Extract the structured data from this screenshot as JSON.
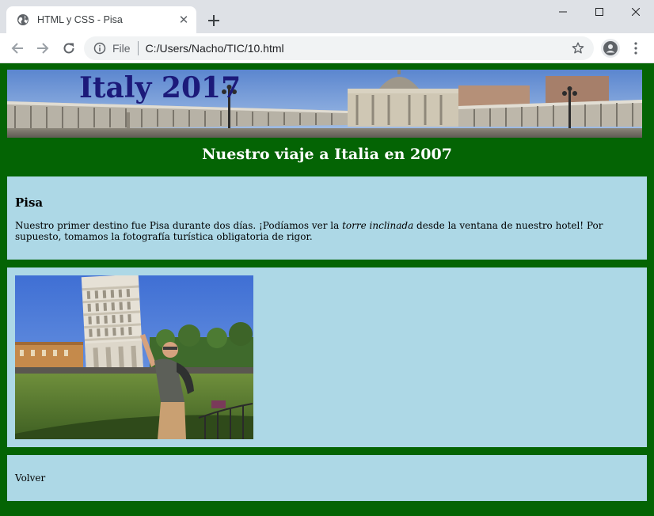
{
  "browser": {
    "tab_title": "HTML y CSS - Pisa",
    "scheme_label": "File",
    "url": "C:/Users/Nacho/TIC/10.html"
  },
  "page": {
    "banner_title": "Italy 2017",
    "heading": "Nuestro viaje a Italia en 2007",
    "section": {
      "title": "Pisa",
      "text_before": "Nuestro primer destino fue Pisa durante dos días. ¡Podíamos ver la ",
      "text_emphasis": "torre inclinada",
      "text_after": " desde la ventana de nuestro hotel! Por supuesto, tomamos la fotografía turística obligatoria de rigor."
    },
    "back_link": "Volver"
  },
  "colors": {
    "page_background": "#046404",
    "box_background": "#add8e6",
    "banner_title": "#1c1a7a"
  }
}
